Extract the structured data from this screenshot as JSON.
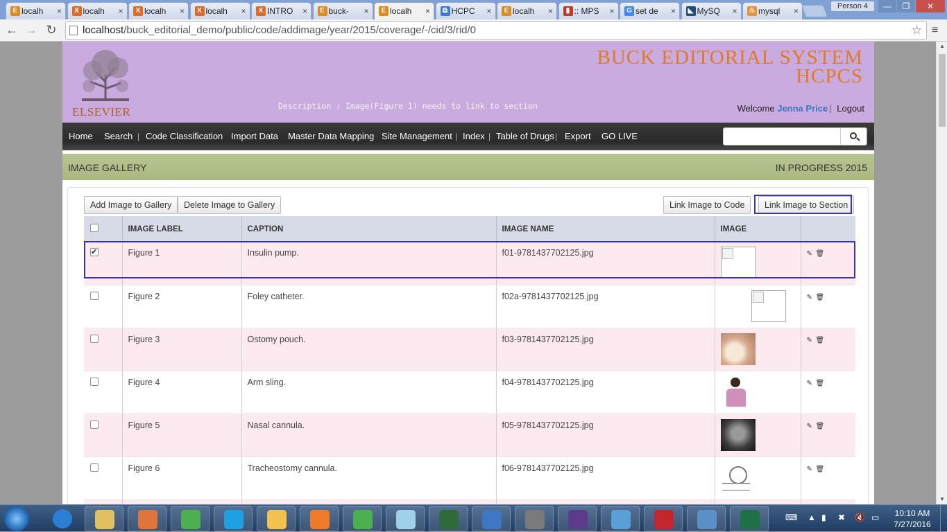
{
  "browser": {
    "tabs": [
      {
        "title": "localh",
        "icon": "E",
        "color": "#e08a1e"
      },
      {
        "title": "localh",
        "icon": "X",
        "color": "#e06a2a"
      },
      {
        "title": "localh",
        "icon": "X",
        "color": "#e06a2a"
      },
      {
        "title": "localh",
        "icon": "X",
        "color": "#e06a2a"
      },
      {
        "title": "INTRO",
        "icon": "X",
        "color": "#e06a2a"
      },
      {
        "title": "buck-",
        "icon": "E",
        "color": "#e08a1e"
      },
      {
        "title": "localh",
        "icon": "E",
        "color": "#e08a1e"
      },
      {
        "title": "HCPC",
        "icon": "⧉",
        "color": "#3a7bd5"
      },
      {
        "title": "localh",
        "icon": "E",
        "color": "#e08a1e"
      },
      {
        "title": ":: MPS",
        "icon": "▮",
        "color": "#c0392b"
      },
      {
        "title": "set de",
        "icon": "G",
        "color": "#4285f4"
      },
      {
        "title": "MySQ",
        "icon": "◣",
        "color": "#1f4e79"
      },
      {
        "title": "mysql",
        "icon": "♨",
        "color": "#e8913a"
      }
    ],
    "active_tab": 6,
    "person": "Person 4",
    "url_host": "localhost",
    "url_path": "/buck_editorial_demo/public/code/addimage/year/2015/coverage/-/cid/3/rid/0"
  },
  "header": {
    "logo_text": "ELSEVIER",
    "title_line1": "BUCK EDITORIAL SYSTEM",
    "title_line2": "HCPCS",
    "description": "Description : Image(Figure 1) needs to link to section",
    "welcome": "Welcome",
    "user_name": "Jenna Price",
    "separator": "|",
    "logout": "Logout"
  },
  "nav": {
    "home": "Home",
    "search": "Search",
    "code_classification": "Code Classification",
    "import_data": "Import Data",
    "master_data_mapping": "Master Data Mapping",
    "site_management": "Site Management",
    "index": "Index",
    "table_of_drugs": "Table of Drugs",
    "export": "Export",
    "go_live": "GO LIVE",
    "sep": "|"
  },
  "subbar": {
    "title": "IMAGE GALLERY",
    "status": "IN PROGRESS  2015"
  },
  "toolbar": {
    "add": "Add Image to Gallery",
    "delete": "Delete Image to Gallery",
    "link_code": "Link Image to Code",
    "link_section": "Link Image to Section"
  },
  "table": {
    "headers": [
      "IMAGE LABEL",
      "CAPTION",
      "IMAGE NAME",
      "IMAGE"
    ],
    "rows": [
      {
        "checked": true,
        "label": "Figure 1",
        "caption": "Insulin pump.",
        "name": "f01-9781437702125.jpg",
        "img": "broken"
      },
      {
        "checked": false,
        "label": "Figure 2",
        "caption": "Foley catheter.",
        "name": "f02a-9781437702125.jpg",
        "img": "broken"
      },
      {
        "checked": false,
        "label": "Figure 3",
        "caption": "Ostomy pouch.",
        "name": "f03-9781437702125.jpg",
        "img": "pouch"
      },
      {
        "checked": false,
        "label": "Figure 4",
        "caption": "Arm sling.",
        "name": "f04-9781437702125.jpg",
        "img": "sling"
      },
      {
        "checked": false,
        "label": "Figure 5",
        "caption": "Nasal cannula.",
        "name": "f05-9781437702125.jpg",
        "img": "nasal"
      },
      {
        "checked": false,
        "label": "Figure 6",
        "caption": "Tracheostomy cannula.",
        "name": "f06-9781437702125.jpg",
        "img": "trach"
      }
    ]
  },
  "taskbar": {
    "time": "10:10 AM",
    "date": "7/27/2016",
    "apps": [
      {
        "icon": "explorer-icon",
        "color": "#e0c060"
      },
      {
        "icon": "media-icon",
        "color": "#e0743a"
      },
      {
        "icon": "chrome-icon",
        "color": "#4caf50"
      },
      {
        "icon": "skype-icon",
        "color": "#1da1e2"
      },
      {
        "icon": "outlook-icon",
        "color": "#f2c14e"
      },
      {
        "icon": "xampp-icon",
        "color": "#f07a2a"
      },
      {
        "icon": "chrome-icon",
        "color": "#4caf50"
      },
      {
        "icon": "notepad-icon",
        "color": "#9fd1e8"
      },
      {
        "icon": "terminal-icon",
        "color": "#2f6b3a"
      },
      {
        "icon": "virtualbox-icon",
        "color": "#3f78c2"
      },
      {
        "icon": "security-icon",
        "color": "#7a7a7a"
      },
      {
        "icon": "java-ee-icon",
        "color": "#5b3b8a"
      },
      {
        "icon": "photo-icon",
        "color": "#5aa0d8"
      },
      {
        "icon": "filezilla-icon",
        "color": "#c1272d"
      },
      {
        "icon": "mysql-icon",
        "color": "#5a8fc7"
      },
      {
        "icon": "excel-icon",
        "color": "#1e7145"
      }
    ]
  }
}
